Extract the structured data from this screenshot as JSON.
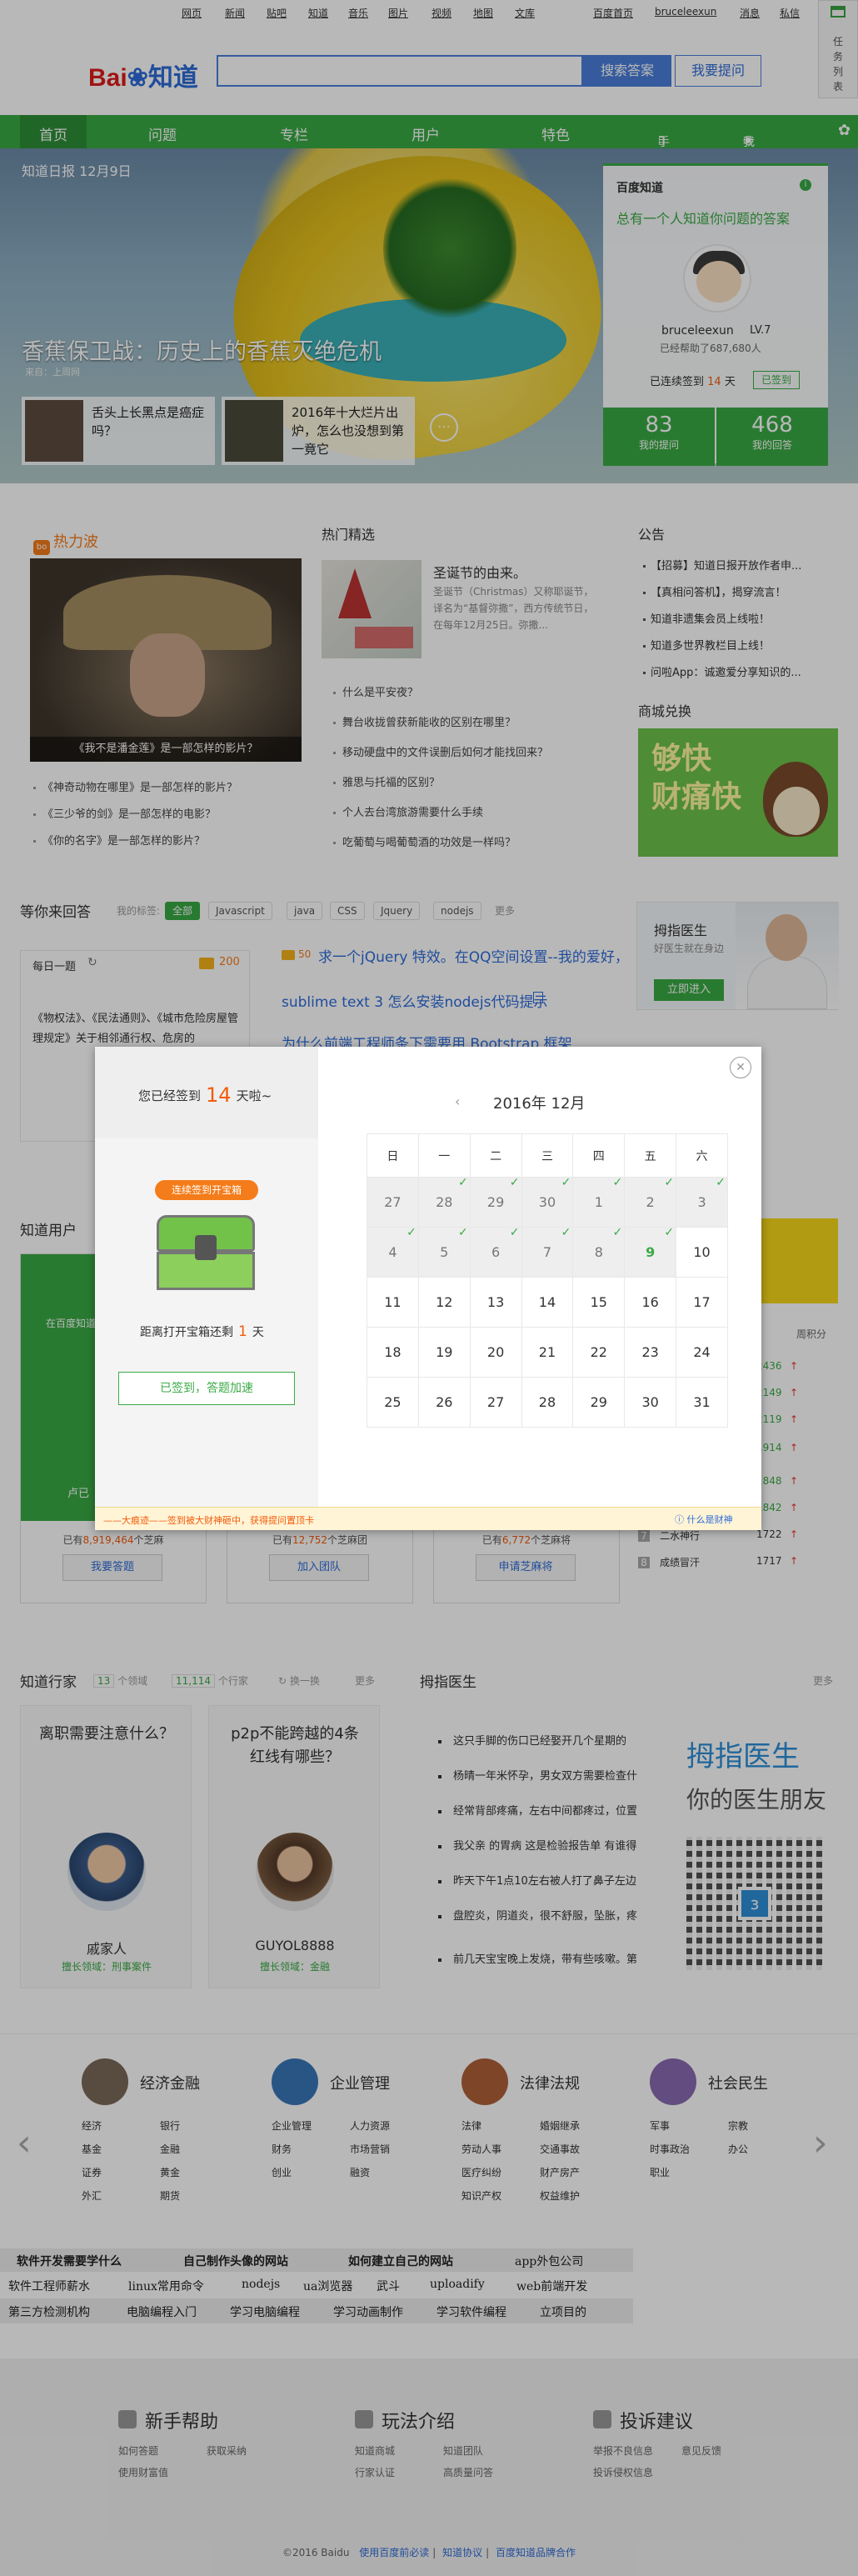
{
  "toplinks": {
    "items": [
      "网页",
      "新闻",
      "贴吧",
      "知道",
      "音乐",
      "图片",
      "视频",
      "地图",
      "文库"
    ],
    "right": [
      "百度首页",
      "bruceleexun",
      "消息",
      "私信"
    ]
  },
  "logo": {
    "bai": "Bai",
    "du": "du",
    "zhidao": "知道"
  },
  "search": {
    "placeholder": "",
    "search_label": "搜索答案",
    "ask_label": "我要提问"
  },
  "sidetool": {
    "label": "任务列表"
  },
  "nav": {
    "items": [
      "首页",
      "问题",
      "专栏",
      "用户",
      "特色"
    ],
    "mobile": "手机版",
    "mine": "我的知道"
  },
  "hero": {
    "date": "知道日报 12月9日",
    "headline": "香蕉保卫战：历史上的香蕉灭绝危机",
    "source": "来自：上周网",
    "cards": [
      "舌头上长黑点是癌症吗？",
      "2016年十大烂片出炉，怎么也没想到第一竟它"
    ]
  },
  "userbox": {
    "title": "百度知道",
    "slogan": "总有一个人知道你问题的答案",
    "username": "bruceleexun",
    "level": "LV.7",
    "helped": "已经帮助了687,680人",
    "signed_prefix": "已连续签到",
    "signed_days": "14",
    "signed_suffix": "天",
    "signed_btn": "已签到",
    "stats": [
      {
        "n": "83",
        "l": "我的提问"
      },
      {
        "n": "468",
        "l": "我的回答"
      }
    ]
  },
  "hot": {
    "title": "热力波",
    "caption": "《我不是潘金莲》是一部怎样的影片？",
    "items": [
      "《神奇动物在哪里》是一部怎样的影片？",
      "《三少爷的剑》是一部怎样的电影？",
      "《你的名字》是一部怎样的影片？"
    ]
  },
  "picks": {
    "title": "热门精选",
    "feature_title": "圣诞节的由来。",
    "feature_desc": "圣诞节（Christmas）又称耶诞节，译名为“基督弥撒”，西方传统节日，在每年12月25日。弥撒...",
    "items": [
      "什么是平安夜？",
      "舞台收拢曾获新能收的区别在哪里？",
      "移动硬盘中的文件误删后如何才能找回来？",
      "雅思与托福的区别？",
      "个人去台湾旅游需要什么手续",
      "吃葡萄与喝葡萄酒的功效是一样吗？"
    ]
  },
  "notice": {
    "title": "公告",
    "items": [
      "【招募】知道日报开放作者申...",
      "【真相问答机】，揭穿流言！",
      "知道非遗集会员上线啦！",
      "知道多世界教栏目上线！",
      "问啦App：诚邀爱分享知识的..."
    ],
    "mall_title": "商城兑换",
    "mall_text1": "够快",
    "mall_text2": "财痛快"
  },
  "answer": {
    "title": "等你来回答",
    "tags_label": "我的标签:",
    "tags": [
      "全部",
      "Javascript",
      "java",
      "CSS",
      "Jquery",
      "nodejs"
    ],
    "more": "更多",
    "daily_title": "每日一题",
    "daily_coins": "200",
    "daily_text": "《物权法》、《民法通则》、《城市危险房屋管理规定》关于相邻通行权、危房的",
    "q_reward": "50",
    "q1": "求一个jQuery 特效。在QQ空间设置--我的爱好，",
    "q2": "sublime text 3 怎么安装nodejs代码提示",
    "q3": "为什么前端工程师条下需要用 Bootstrap 框架",
    "doctor_title": "拇指医生",
    "doctor_desc": "好医生就在身边",
    "doctor_btn": "立即进入"
  },
  "modal": {
    "signed_prefix": "您已经签到",
    "signed_days": "14",
    "signed_suffix": "天啦~",
    "badge": "连续签到开宝箱",
    "remain_prefix": "距离打开宝箱还剩",
    "remain_days": "1",
    "remain_suffix": "天",
    "accel": "已签到，答题加速",
    "month": "2016年 12月",
    "weekdays": [
      "日",
      "一",
      "二",
      "三",
      "四",
      "五",
      "六"
    ],
    "weeks": [
      [
        "27",
        "28",
        "29",
        "30",
        "1",
        "2",
        "3"
      ],
      [
        "4",
        "5",
        "6",
        "7",
        "8",
        "9",
        "10"
      ],
      [
        "11",
        "12",
        "13",
        "14",
        "15",
        "16",
        "17"
      ],
      [
        "18",
        "19",
        "20",
        "21",
        "22",
        "23",
        "24"
      ],
      [
        "25",
        "26",
        "27",
        "28",
        "29",
        "30",
        "31"
      ]
    ],
    "foot_left": "——大痕迹——签到被大财神砸中，获得提问置顶卡",
    "foot_right": "什么是财神"
  },
  "users": {
    "title": "知道用户",
    "card_sub": "在百度知道",
    "card_name": "卢已",
    "cards": [
      {
        "prefix": "已有",
        "count": "8,919,464",
        "suffix": "个芝麻",
        "btn": "我要答题"
      },
      {
        "prefix": "已有",
        "count": "12,752",
        "suffix": "个芝麻团",
        "btn": "加入团队"
      },
      {
        "prefix": "已有",
        "count": "6,772",
        "suffix": "个芝麻将",
        "btn": "申请芝麻将"
      }
    ],
    "rank_header": "周积分",
    "ranks": [
      {
        "name": "",
        "v": "2436"
      },
      {
        "name": "",
        "v": "2149"
      },
      {
        "name": "",
        "v": "2119"
      },
      {
        "name": "",
        "v": "1914"
      },
      {
        "name": "",
        "v": "1848"
      },
      {
        "name": "",
        "v": "1842"
      },
      {
        "name": "二水神行",
        "v": "1722"
      },
      {
        "name": "成绩冒汗",
        "v": "1717"
      }
    ],
    "rank_nums": [
      "7",
      "8"
    ]
  },
  "experts": {
    "title": "知道行家",
    "count1": "13",
    "unit1": "个领域",
    "count2": "11,114",
    "unit2": "个行家",
    "shuffle": "换一换",
    "more": "更多",
    "cards": [
      {
        "q": "离职需要注意什么？",
        "name": "戚家人",
        "field": "擅长领域：刑事案件"
      },
      {
        "q": "p2p不能跨越的4条红线有哪些？",
        "name": "GUYOL8888",
        "field": "擅长领域：金融"
      }
    ]
  },
  "mdoctor": {
    "title": "拇指医生",
    "more": "更多",
    "lines": [
      "这只手脚的伤口已经娶开几个星期的",
      "杨晴一年米怀孕，男女双方需要检查什",
      "经常背部疼痛，左右中间都疼过，位置",
      "我父亲 的胃病 这是检验报告单 有谁得",
      "昨天下午1点10左右被人打了鼻子左边",
      "盘腔炎，阴道炎，很不舒服，坠胀，疼",
      "前几天宝宝晚上发烧，带有些咳嗽。第"
    ],
    "brand1": "拇指医生",
    "brand2": "你的医生朋友"
  },
  "categories": [
    {
      "title": "经济金融",
      "items": [
        "经济",
        "银行",
        "基金",
        "金融",
        "证券",
        "黄金",
        "外汇",
        "期货"
      ]
    },
    {
      "title": "企业管理",
      "items": [
        "企业管理",
        "人力资源",
        "财务",
        "市场营销",
        "创业",
        "融资"
      ]
    },
    {
      "title": "法律法规",
      "items": [
        "法律",
        "婚姻继承",
        "劳动人事",
        "交通事故",
        "医疗纠纷",
        "财产房产",
        "知识产权",
        "权益维护"
      ]
    },
    {
      "title": "社会民生",
      "items": [
        "军事",
        "宗教",
        "时事政治",
        "办公",
        "职业"
      ]
    }
  ],
  "keywords": {
    "row1": [
      "软件开发需要学什么",
      "自己制作头像的网站",
      "如何建立自己的网站",
      "app外包公司"
    ],
    "row2": [
      "软件工程师薪水",
      "linux常用命令",
      "nodejs",
      "ua浏览器",
      "武斗",
      "uploadify",
      "web前端开发"
    ],
    "row3": [
      "第三方检测机构",
      "电脑编程入门",
      "学习电脑编程",
      "学习动画制作",
      "学习软件编程",
      "立项目的"
    ]
  },
  "footer": {
    "cols": [
      {
        "h": "新手帮助",
        "links": [
          "如何答题",
          "获取采纳",
          "使用财富值"
        ]
      },
      {
        "h": "玩法介绍",
        "links": [
          "知道商城",
          "知道团队",
          "行家认证",
          "高质量问答"
        ]
      },
      {
        "h": "投诉建议",
        "links": [
          "举报不良信息",
          "意见反馈",
          "投诉侵权信息"
        ]
      }
    ],
    "copyright": "©2016 Baidu",
    "links": [
      "使用百度前必读",
      "知道协议",
      "百度知道品牌合作"
    ]
  }
}
